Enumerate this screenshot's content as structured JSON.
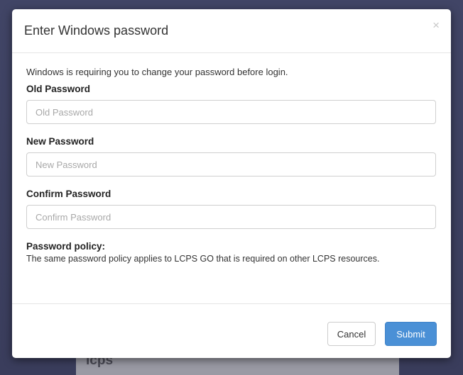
{
  "background": {
    "card_text": "lcps"
  },
  "modal": {
    "title": "Enter Windows password",
    "close_glyph": "×",
    "intro": "Windows is requiring you to change your password before login.",
    "fields": [
      {
        "label": "Old Password",
        "placeholder": "Old Password",
        "value": ""
      },
      {
        "label": "New Password",
        "placeholder": "New Password",
        "value": ""
      },
      {
        "label": "Confirm Password",
        "placeholder": "Confirm Password",
        "value": ""
      }
    ],
    "policy": {
      "title": "Password policy:",
      "text": "The same password policy applies to LCPS GO that is required on other LCPS resources."
    },
    "buttons": {
      "cancel": "Cancel",
      "submit": "Submit"
    }
  },
  "colors": {
    "primary": "#4a90d6",
    "backdrop": "#3b3f5f"
  }
}
